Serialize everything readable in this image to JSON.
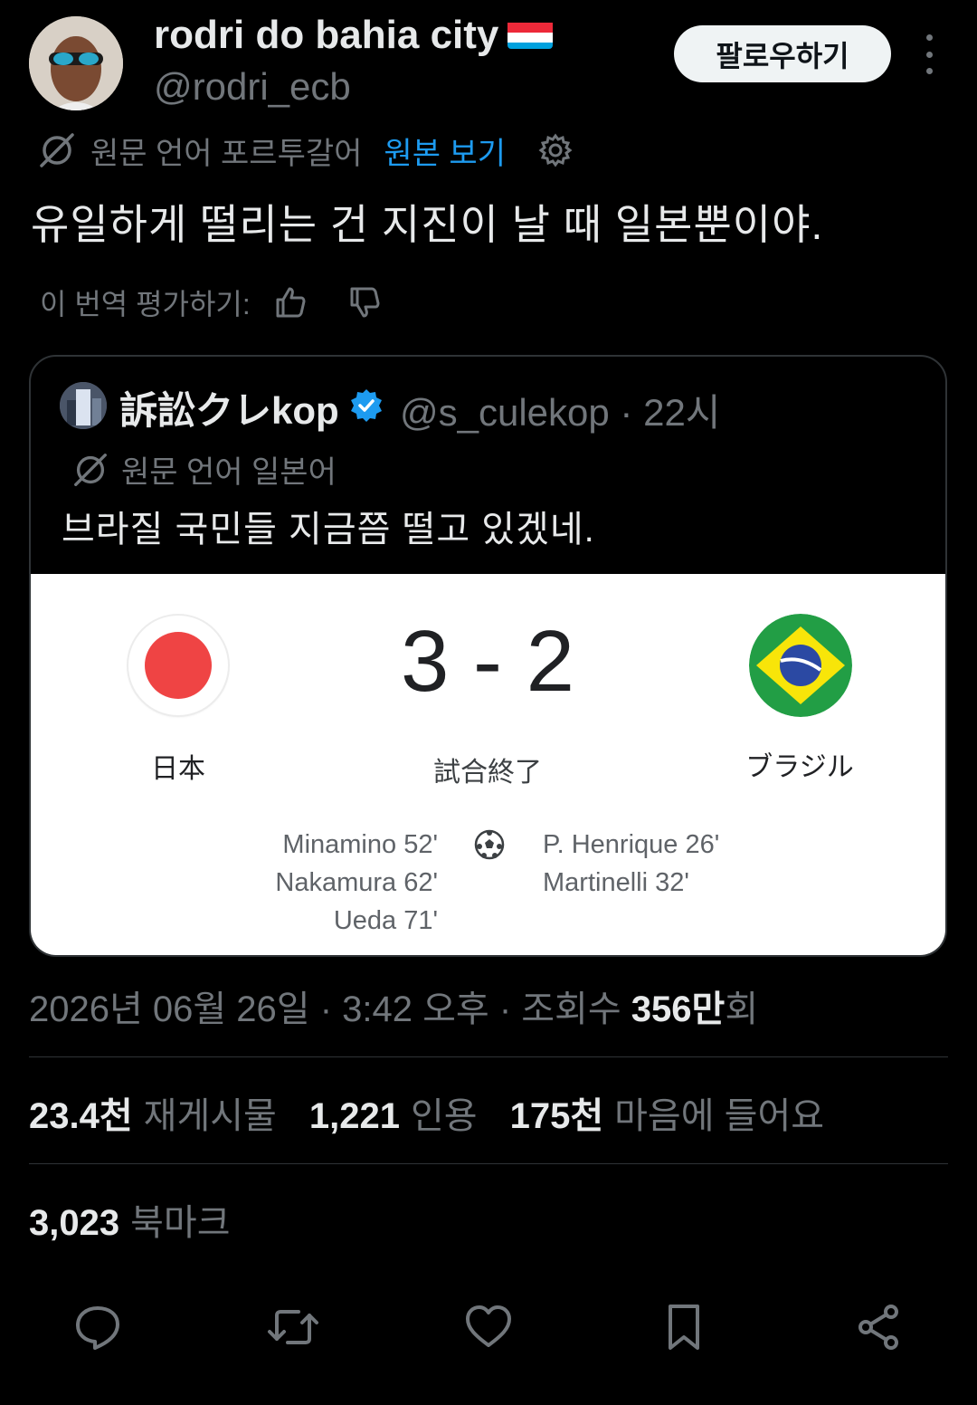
{
  "author": {
    "display_name": "rodri do bahia city",
    "flag_icon": "luxembourg-flag-icon",
    "handle": "@rodri_ecb",
    "follow_label": "팔로우하기"
  },
  "translation": {
    "source_language_text": "원문 언어 포르투갈어",
    "view_original_label": "원본 보기"
  },
  "tweet_text": "유일하게 떨리는 건 지진이 날 때 일본뿐이야.",
  "rate_translation_label": "이 번역 평가하기:",
  "quote": {
    "display_name": "訴訟クレkop",
    "handle_time": "@s_culekop · 22시",
    "source_language_text": "원문 언어 일본어",
    "text": "브라질 국민들 지금쯤 떨고 있겠네.",
    "match": {
      "score": "3 - 2",
      "status": "試合終了",
      "home_team": "日本",
      "away_team": "ブラジル",
      "home_scorers": [
        "Minamino 52'",
        "Nakamura 62'",
        "Ueda 71'"
      ],
      "away_scorers": [
        "P.  Henrique 26'",
        "Martinelli 32'"
      ]
    }
  },
  "meta": {
    "date_time": "2026년 06월 26일 · 3:42 오후 · 조회수 ",
    "views_count": "356만",
    "views_suffix": "회"
  },
  "stats": {
    "reposts_count": "23.4천",
    "reposts_label": "재게시물",
    "quotes_count": "1,221",
    "quotes_label": "인용",
    "likes_count": "175천",
    "likes_label": "마음에 들어요",
    "bookmarks_count": "3,023",
    "bookmarks_label": "북마크"
  },
  "colors": {
    "background": "#000000",
    "accent_blue": "#1d9bf0",
    "muted": "#71767b",
    "text": "#e7e9ea"
  }
}
